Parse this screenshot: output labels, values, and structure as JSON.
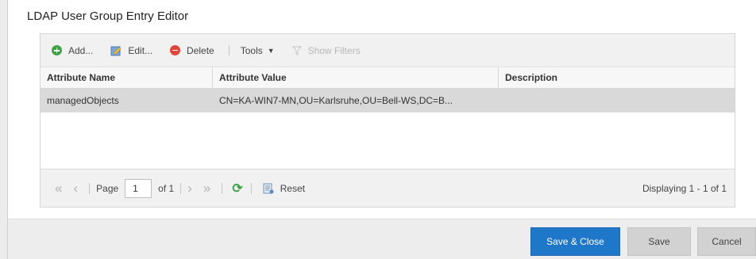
{
  "dialog": {
    "title": "LDAP User Group Entry Editor"
  },
  "toolbar": {
    "add_label": "Add...",
    "edit_label": "Edit...",
    "delete_label": "Delete",
    "tools_label": "Tools",
    "show_filters_label": "Show Filters"
  },
  "grid": {
    "columns": [
      "Attribute Name",
      "Attribute Value",
      "Description"
    ],
    "rows": [
      {
        "name": "managedObjects",
        "value": "CN=KA-WIN7-MN,OU=Karlsruhe,OU=Bell-WS,DC=B...",
        "description": ""
      }
    ]
  },
  "pager": {
    "page_label": "Page",
    "page_value": "1",
    "of_label": "of 1",
    "reset_label": "Reset",
    "displaying": "Displaying 1 - 1 of 1"
  },
  "footer": {
    "save_close_label": "Save & Close",
    "save_label": "Save",
    "cancel_label": "Cancel"
  },
  "colors": {
    "primary": "#1f77c9",
    "selected_row": "#d9d9d9",
    "add_icon": "#3fa34a",
    "delete_icon": "#e0473b"
  },
  "icons": [
    "add-icon",
    "edit-icon",
    "delete-icon",
    "caret-down-icon",
    "filter-icon",
    "first-page-icon",
    "prev-page-icon",
    "next-page-icon",
    "last-page-icon",
    "refresh-icon",
    "reset-icon"
  ]
}
